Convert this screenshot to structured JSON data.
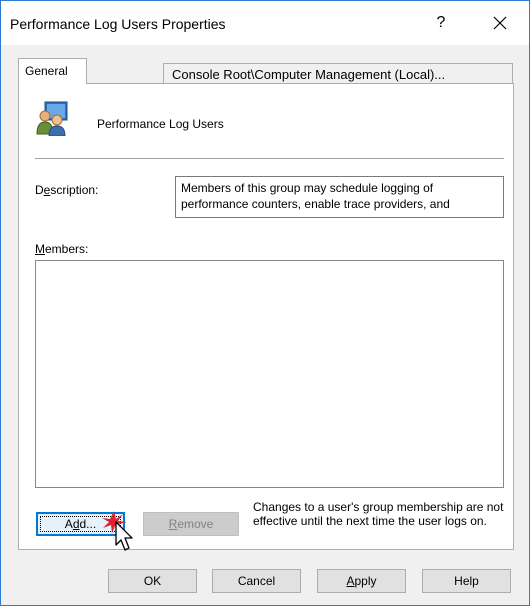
{
  "window": {
    "title": "Performance Log Users Properties",
    "help_glyph": "?",
    "close_icon": "close-icon"
  },
  "tabs": {
    "general": "General",
    "path": "Console Root\\Computer Management (Local)..."
  },
  "group": {
    "icon": "group-users-icon",
    "name": "Performance Log Users"
  },
  "description": {
    "label_accel": "e",
    "label_pre": "D",
    "label_post": "scription:",
    "text": "Members of this group may schedule logging of performance counters, enable trace providers, and"
  },
  "members": {
    "label_accel": "M",
    "label_post": "embers:",
    "items": []
  },
  "buttons": {
    "add_accel": "d",
    "add_pre": "A",
    "add_post": "d...",
    "remove_accel": "R",
    "remove_post": "emove",
    "ok": "OK",
    "cancel": "Cancel",
    "apply_accel": "A",
    "apply_post": "pply",
    "help": "Help"
  },
  "note": "Changes to a user's group membership are not effective until the next time the user logs on.",
  "colors": {
    "accent": "#0078d7",
    "window_border": "#2b7bd3",
    "click_marker": "#e0202a"
  }
}
